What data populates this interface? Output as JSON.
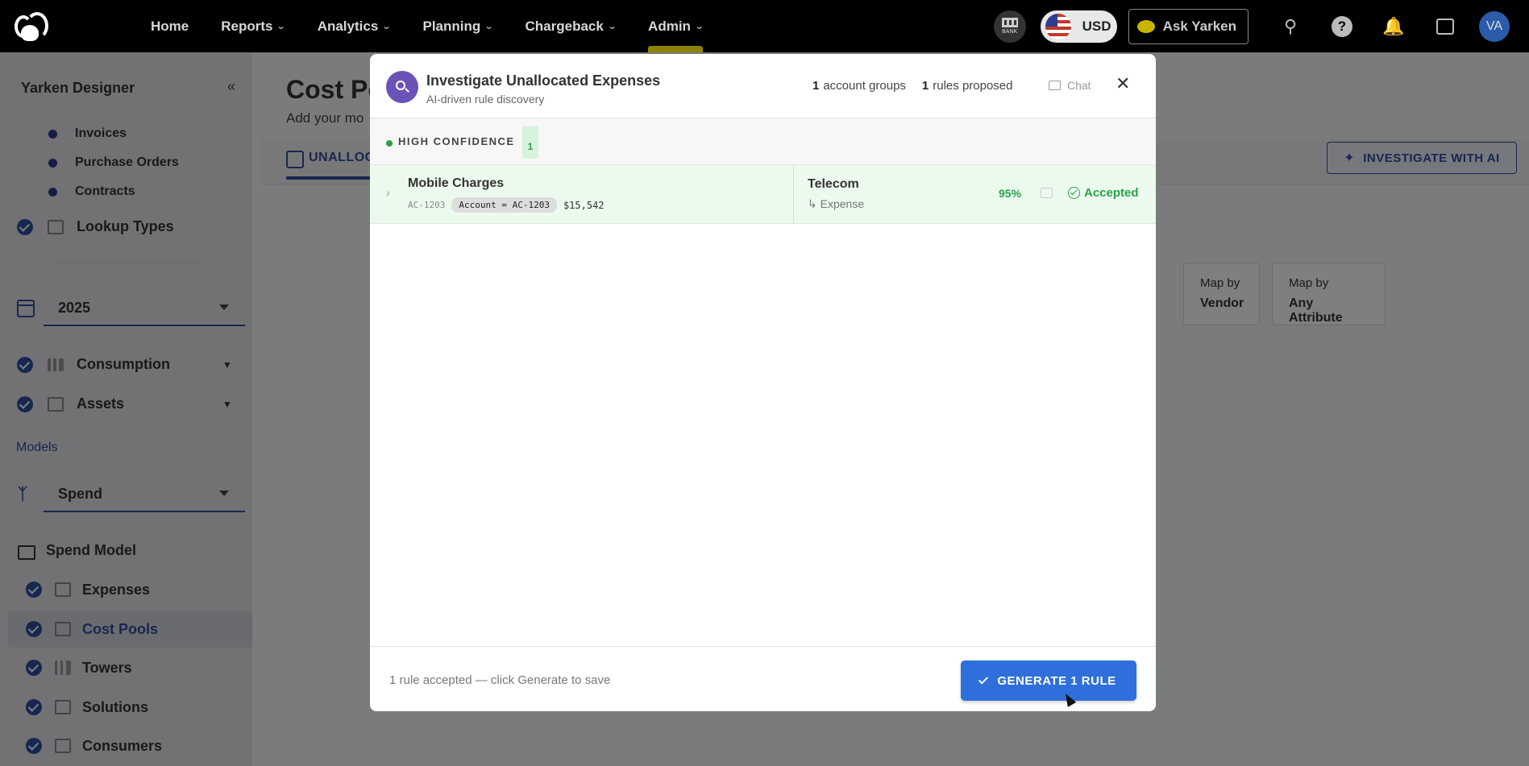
{
  "nav": {
    "items": [
      "Home",
      "Reports",
      "Analytics",
      "Planning",
      "Chargeback",
      "Admin"
    ],
    "bank_label": "BANK",
    "currency": "USD",
    "ask_label": "Ask Yarken",
    "avatar_initials": "VA"
  },
  "sidebar": {
    "title": "Yarken Designer",
    "dot_items": [
      "Invoices",
      "Purchase Orders",
      "Contracts"
    ],
    "lookup_types": "Lookup Types",
    "year": "2025",
    "consumption": "Consumption",
    "assets": "Assets",
    "models_label": "Models",
    "model_select": "Spend",
    "spend_model": "Spend Model",
    "sub_items": [
      "Expenses",
      "Cost Pools",
      "Towers",
      "Solutions",
      "Consumers"
    ],
    "active_item": "Cost Pools"
  },
  "main": {
    "title": "Cost Po",
    "subtitle": "Add your mo",
    "tab": "UNALLOC",
    "investigate_button": "INVESTIGATE WITH AI",
    "map_cards": [
      {
        "label": "Map by",
        "value": "Vendor"
      },
      {
        "label": "Map by",
        "value": "Any Attribute"
      }
    ]
  },
  "modal": {
    "title": "Investigate Unallocated Expenses",
    "subtitle": "AI-driven rule discovery",
    "account_groups_count": "1",
    "account_groups_label": "account groups",
    "rules_count": "1",
    "rules_label": "rules proposed",
    "chat_label": "Chat",
    "section": {
      "label": "HIGH CONFIDENCE",
      "count": "1"
    },
    "rules": [
      {
        "name": "Mobile Charges",
        "code": "AC-1203",
        "condition": "Account = AC-1203",
        "amount": "$15,542",
        "target": "Telecom",
        "parent": "↳ Expense",
        "confidence": "95%",
        "status": "Accepted"
      }
    ],
    "footer_text": "1 rule accepted — click Generate to save",
    "generate_button": "GENERATE 1 RULE"
  }
}
